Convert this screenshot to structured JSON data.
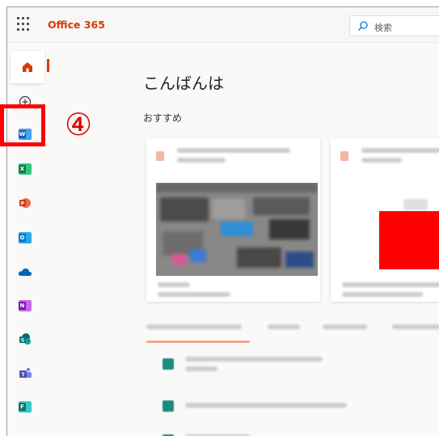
{
  "header": {
    "brand": "Office 365",
    "search_placeholder": "検索"
  },
  "annotation": {
    "step_number": "④",
    "highlight_color": "#ff0000"
  },
  "main": {
    "greeting": "こんばんは",
    "recommended_label": "おすすめ"
  },
  "rail": {
    "items": [
      {
        "name": "home",
        "icon": "home-icon"
      },
      {
        "name": "create",
        "icon": "plus-circle-icon"
      },
      {
        "name": "word",
        "icon": "word-icon",
        "letter": "W",
        "color": "#2b579a"
      },
      {
        "name": "excel",
        "icon": "excel-icon",
        "letter": "X",
        "color": "#217346"
      },
      {
        "name": "powerpoint",
        "icon": "powerpoint-icon",
        "letter": "P",
        "color": "#d24726"
      },
      {
        "name": "outlook",
        "icon": "outlook-icon",
        "letter": "O",
        "color": "#0078d4"
      },
      {
        "name": "onedrive",
        "icon": "onedrive-icon",
        "color": "#0364b8"
      },
      {
        "name": "onenote",
        "icon": "onenote-icon",
        "letter": "N",
        "color": "#7719aa"
      },
      {
        "name": "sharepoint",
        "icon": "sharepoint-icon",
        "letter": "S",
        "color": "#038387"
      },
      {
        "name": "teams",
        "icon": "teams-icon",
        "color": "#4b53bc"
      },
      {
        "name": "sway",
        "icon": "sway-icon",
        "color": "#077568"
      }
    ]
  },
  "colors": {
    "brand": "#d83b01",
    "accent_underline": "#f2a48a"
  }
}
